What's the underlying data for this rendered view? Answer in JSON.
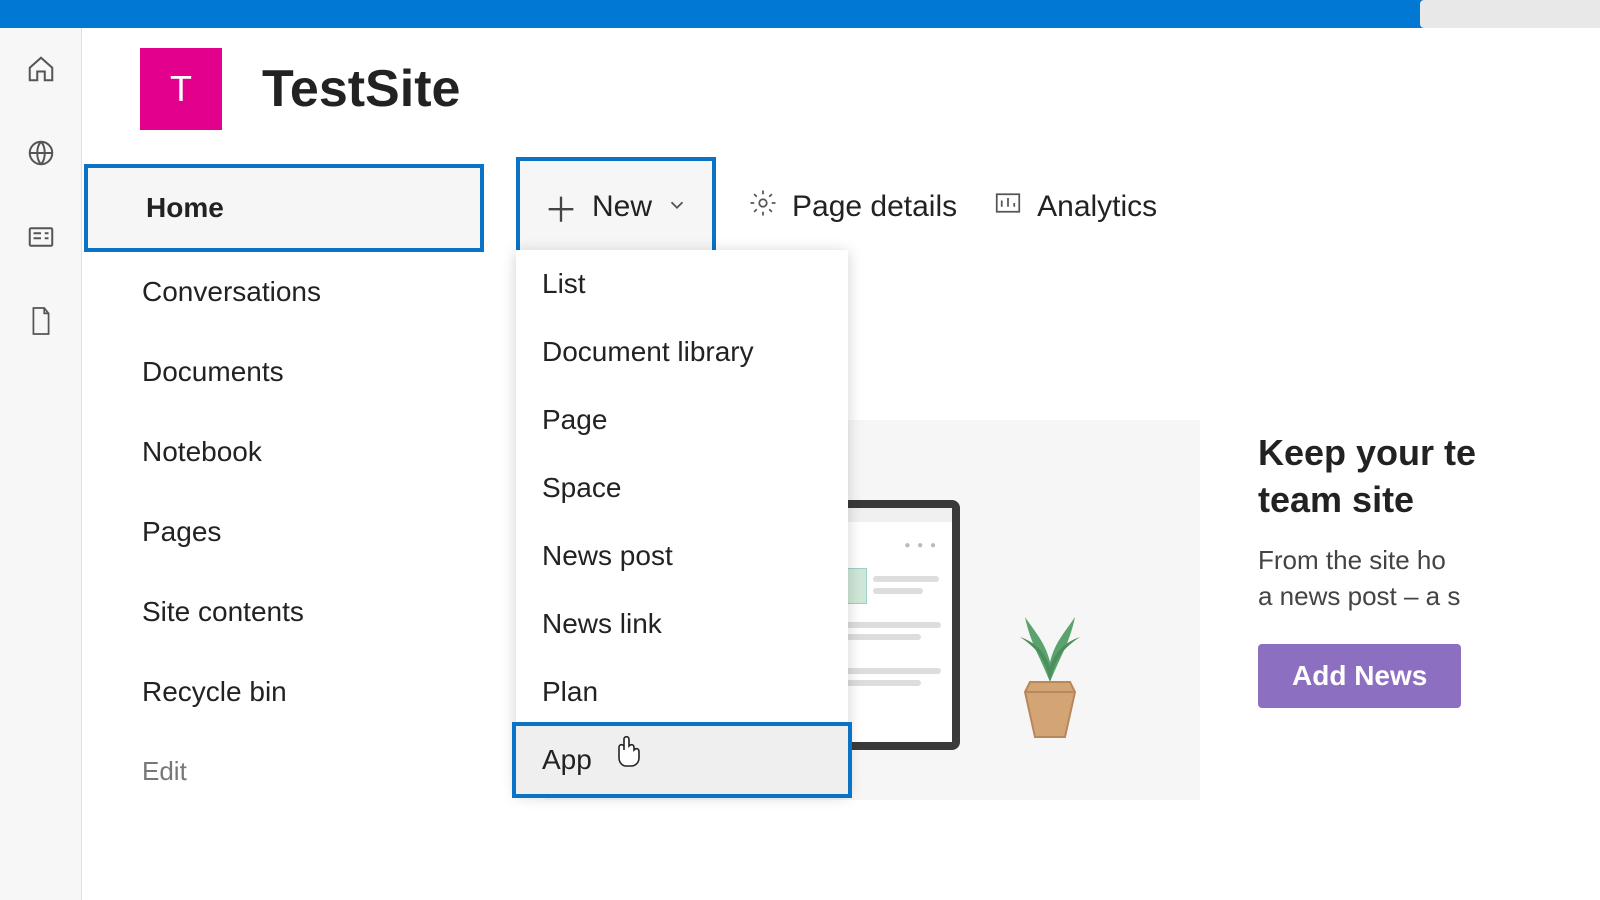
{
  "site": {
    "letter": "T",
    "title": "TestSite"
  },
  "nav": {
    "home": "Home",
    "conversations": "Conversations",
    "documents": "Documents",
    "notebook": "Notebook",
    "pages": "Pages",
    "site_contents": "Site contents",
    "recycle_bin": "Recycle bin",
    "edit": "Edit"
  },
  "commands": {
    "new": "New",
    "page_details": "Page details",
    "analytics": "Analytics"
  },
  "new_menu": {
    "list": "List",
    "document_library": "Document library",
    "page": "Page",
    "space": "Space",
    "news_post": "News post",
    "news_link": "News link",
    "plan": "Plan",
    "app": "App"
  },
  "info": {
    "heading_line1": "Keep your te",
    "heading_line2": "team site",
    "body_line1": "From the site ho",
    "body_line2": "a news post – a s",
    "add_news": "Add News"
  }
}
